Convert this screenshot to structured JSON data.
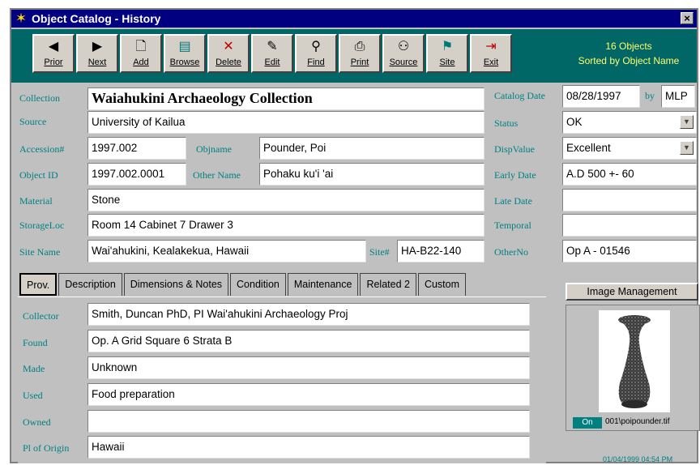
{
  "window": {
    "title": "Object Catalog - History",
    "close_glyph": "×"
  },
  "toolbar": {
    "buttons": [
      {
        "label": "Prior",
        "icon": "◀"
      },
      {
        "label": "Next",
        "icon": "▶"
      },
      {
        "label": "Add",
        "icon": "🗋"
      },
      {
        "label": "Browse",
        "icon": "▤"
      },
      {
        "label": "Delete",
        "icon": "✕"
      },
      {
        "label": "Edit",
        "icon": "✎"
      },
      {
        "label": "Find",
        "icon": "⚲"
      },
      {
        "label": "Print",
        "icon": "⎙"
      },
      {
        "label": "Source",
        "icon": "⚇"
      },
      {
        "label": "Site",
        "icon": "⚑"
      },
      {
        "label": "Exit",
        "icon": "⇥"
      }
    ],
    "status_line1": "16 Objects",
    "status_line2": "Sorted by Object Name"
  },
  "form": {
    "collection": {
      "label": "Collection",
      "value": "Waiahukini Archaeology Collection"
    },
    "source": {
      "label": "Source",
      "value": "University of Kailua"
    },
    "accession": {
      "label": "Accession#",
      "value": "1997.002"
    },
    "objname": {
      "label": "Objname",
      "value": "Pounder, Poi"
    },
    "object_id": {
      "label": "Object ID",
      "value": "1997.002.0001"
    },
    "other_name": {
      "label": "Other Name",
      "value": "Pohaku ku'i 'ai"
    },
    "material": {
      "label": "Material",
      "value": "Stone"
    },
    "storage_loc": {
      "label": "StorageLoc",
      "value": "Room 14 Cabinet 7 Drawer 3"
    },
    "site_name": {
      "label": "Site Name",
      "value": "Wai'ahukini, Kealakekua, Hawaii"
    },
    "site_num": {
      "label": "Site#",
      "value": "HA-B22-140"
    },
    "catalog_date": {
      "label": "Catalog Date",
      "value": "08/28/1997"
    },
    "by": {
      "label": "by",
      "value": "MLP"
    },
    "status": {
      "label": "Status",
      "value": "OK"
    },
    "disp_value": {
      "label": "DispValue",
      "value": "Excellent"
    },
    "early_date": {
      "label": "Early Date",
      "value": "A.D 500 +- 60"
    },
    "late_date": {
      "label": "Late Date",
      "value": ""
    },
    "temporal": {
      "label": "Temporal",
      "value": ""
    },
    "other_no": {
      "label": "OtherNo",
      "value": "Op A - 01546"
    }
  },
  "tabs": [
    "Prov.",
    "Description",
    "Dimensions & Notes",
    "Condition",
    "Maintenance",
    "Related 2",
    "Custom"
  ],
  "prov": {
    "collector": {
      "label": "Collector",
      "value": "Smith, Duncan PhD, PI Wai'ahukini Archaeology Proj"
    },
    "found": {
      "label": "Found",
      "value": "Op. A Grid Square 6 Strata B"
    },
    "made": {
      "label": "Made",
      "value": "Unknown"
    },
    "used": {
      "label": "Used",
      "value": "Food preparation"
    },
    "owned": {
      "label": "Owned",
      "value": ""
    },
    "place_of_origin": {
      "label": "Pl of Origin",
      "value": "Hawaii"
    }
  },
  "image_panel": {
    "button_label": "Image Management",
    "on_label": "On",
    "filename": "001\\poipounder.tif"
  },
  "timestamp": "01/04/1999 04:54 PM",
  "colors": {
    "title_bg": "#000080",
    "toolbar_bg": "#006666",
    "label": "#008080",
    "status_text": "#ffff66"
  },
  "icons": {
    "app": "star-icon",
    "close": "close-icon",
    "dropdown": "dropdown-arrow-icon",
    "image": "poi-pounder-image"
  }
}
